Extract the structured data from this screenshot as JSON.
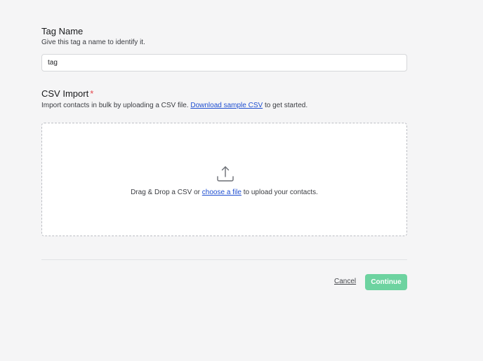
{
  "tag_section": {
    "title": "Tag Name",
    "description": "Give this tag a name to identify it.",
    "input_value": "tag"
  },
  "csv_section": {
    "title": "CSV Import",
    "required_marker": "*",
    "description_prefix": "Import contacts in bulk by uploading a CSV file.",
    "download_link": "Download sample CSV",
    "description_suffix": "to get started."
  },
  "dropzone": {
    "icon": "upload-icon",
    "text_prefix": "Drag & Drop a CSV or",
    "choose_link": "choose a file",
    "text_suffix": "to upload your contacts."
  },
  "footer": {
    "cancel_label": "Cancel",
    "continue_label": "Continue"
  },
  "colors": {
    "background": "#f5f5f6",
    "link": "#1f4fd1",
    "required": "#e5484d",
    "continue_button": "#6dd3a0"
  }
}
